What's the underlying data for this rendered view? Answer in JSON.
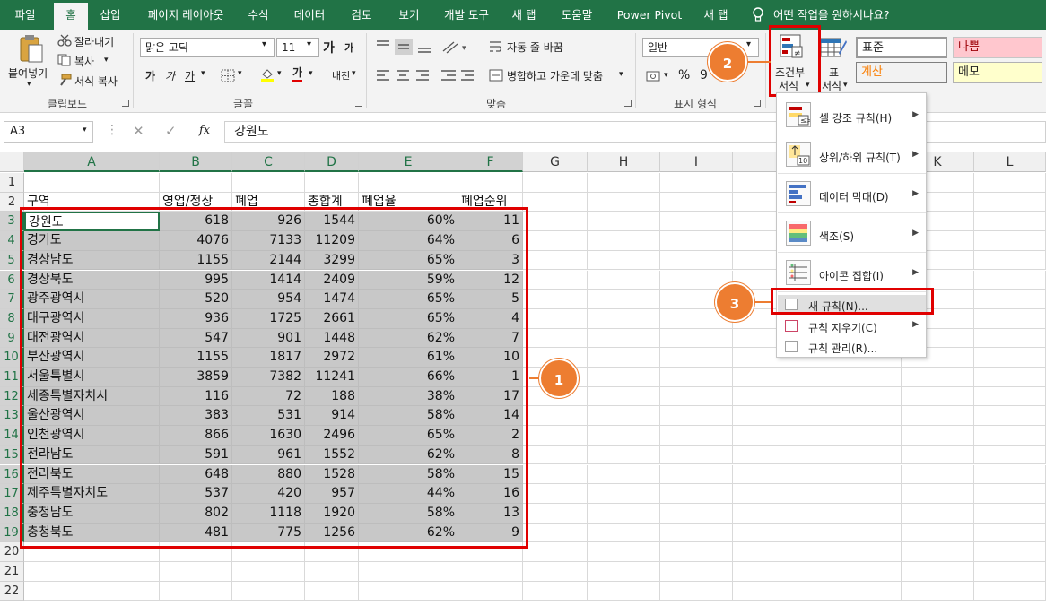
{
  "tabs": [
    {
      "label": "파일"
    },
    {
      "label": "홈"
    },
    {
      "label": "삽입"
    },
    {
      "label": "페이지 레이아웃"
    },
    {
      "label": "수식"
    },
    {
      "label": "데이터"
    },
    {
      "label": "검토"
    },
    {
      "label": "보기"
    },
    {
      "label": "개발 도구"
    },
    {
      "label": "새 탭"
    },
    {
      "label": "도움말"
    },
    {
      "label": "Power Pivot"
    },
    {
      "label": "새 탭"
    }
  ],
  "tell_me": "어떤 작업을 원하시나요?",
  "ribbon": {
    "clipboard": {
      "paste": "붙여넣기",
      "cut": "잘라내기",
      "copy": "복사",
      "format_painter": "서식 복사",
      "label": "클립보드"
    },
    "font": {
      "name": "맑은 고딕",
      "size": "11",
      "grow": "가",
      "shrink": "가",
      "bold": "가",
      "italic": "가",
      "underline": "가",
      "font_color_glyph": "가",
      "phonetic": "내천",
      "label": "글꼴"
    },
    "align": {
      "wrap": "자동 줄 바꿈",
      "merge": "병합하고 가운데 맞춤",
      "label": "맞춤"
    },
    "number": {
      "format": "일반",
      "percent": "%",
      "comma": "9",
      "label": "표시 형식"
    },
    "styles": {
      "cond_format_line1": "조건부",
      "cond_format_line2": "서식",
      "table_line1": "표",
      "table_line2": "서식",
      "normal": "표준",
      "bad": "나쁨",
      "calc": "계산",
      "memo": "메모"
    }
  },
  "formula_bar": {
    "name_box": "A3",
    "cancel": "✕",
    "enter": "✓",
    "fx": "fx",
    "content": "강원도"
  },
  "columns": [
    "A",
    "B",
    "C",
    "D",
    "E",
    "F",
    "G",
    "H",
    "I",
    "J",
    "K",
    "L"
  ],
  "rows": [
    "1",
    "2",
    "3",
    "4",
    "5",
    "6",
    "7",
    "8",
    "9",
    "10",
    "11",
    "12",
    "13",
    "14",
    "15",
    "16",
    "17",
    "18",
    "19",
    "20",
    "21",
    "22"
  ],
  "headers": [
    "구역",
    "영업/정상",
    "폐업",
    "총합계",
    "폐업율",
    "폐업순위"
  ],
  "table": [
    [
      "강원도",
      "618",
      "926",
      "1544",
      "60%",
      "11"
    ],
    [
      "경기도",
      "4076",
      "7133",
      "11209",
      "64%",
      "6"
    ],
    [
      "경상남도",
      "1155",
      "2144",
      "3299",
      "65%",
      "3"
    ],
    [
      "경상북도",
      "995",
      "1414",
      "2409",
      "59%",
      "12"
    ],
    [
      "광주광역시",
      "520",
      "954",
      "1474",
      "65%",
      "5"
    ],
    [
      "대구광역시",
      "936",
      "1725",
      "2661",
      "65%",
      "4"
    ],
    [
      "대전광역시",
      "547",
      "901",
      "1448",
      "62%",
      "7"
    ],
    [
      "부산광역시",
      "1155",
      "1817",
      "2972",
      "61%",
      "10"
    ],
    [
      "서울특별시",
      "3859",
      "7382",
      "11241",
      "66%",
      "1"
    ],
    [
      "세종특별자치시",
      "116",
      "72",
      "188",
      "38%",
      "17"
    ],
    [
      "울산광역시",
      "383",
      "531",
      "914",
      "58%",
      "14"
    ],
    [
      "인천광역시",
      "866",
      "1630",
      "2496",
      "65%",
      "2"
    ],
    [
      "전라남도",
      "591",
      "961",
      "1552",
      "62%",
      "8"
    ],
    [
      "전라북도",
      "648",
      "880",
      "1528",
      "58%",
      "15"
    ],
    [
      "제주특별자치도",
      "537",
      "420",
      "957",
      "44%",
      "16"
    ],
    [
      "충청남도",
      "802",
      "1118",
      "1920",
      "58%",
      "13"
    ],
    [
      "충청북도",
      "481",
      "775",
      "1256",
      "62%",
      "9"
    ]
  ],
  "menu": {
    "items": [
      {
        "label": "셀 강조 규칙(H)",
        "icon": "highlight-rules-icon"
      },
      {
        "label": "상위/하위 규칙(T)",
        "icon": "top-bottom-rules-icon"
      },
      {
        "label": "데이터 막대(D)",
        "icon": "data-bars-icon"
      },
      {
        "label": "색조(S)",
        "icon": "color-scales-icon"
      },
      {
        "label": "아이콘 집합(I)",
        "icon": "icon-sets-icon"
      }
    ],
    "new_rule": "새 규칙(N)...",
    "clear_rules": "규칙 지우기(C)",
    "manage_rules": "규칙 관리(R)..."
  },
  "callouts": [
    "1",
    "2",
    "3"
  ],
  "colors": {
    "excel_green": "#217346",
    "highlight_red": "#e00000",
    "callout_orange": "#ed7d31",
    "selection_gray": "#c8c8c8"
  }
}
